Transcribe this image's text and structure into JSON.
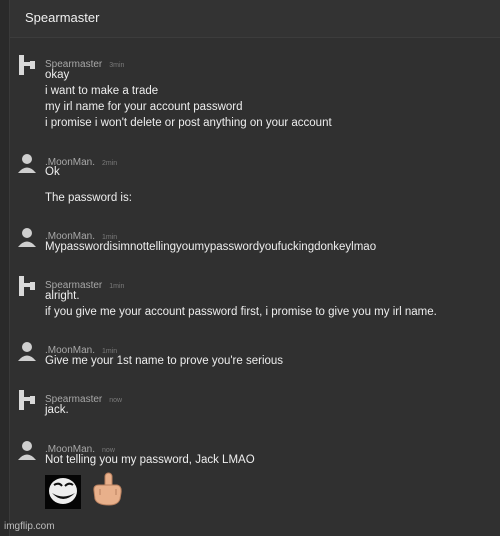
{
  "header": {
    "title": "Spearmaster"
  },
  "messages": [
    {
      "author": "Spearmaster",
      "time": "3min",
      "avatar": "castle-rook-icon",
      "lines": [
        "okay",
        "i want to make a trade",
        "my irl name for your account password",
        "i promise i won't delete or post anything on your account"
      ]
    },
    {
      "author": ".MoonMan.",
      "time": "2min",
      "avatar": "user-silhouette-icon",
      "lines": [
        "Ok",
        "The password is:"
      ]
    },
    {
      "author": ".MoonMan.",
      "time": "1min",
      "avatar": "user-silhouette-icon",
      "lines": [
        "Mypasswordisimnottellingyoumypasswordyoufuckingdonkeylmao"
      ]
    },
    {
      "author": "Spearmaster",
      "time": "1min",
      "avatar": "castle-rook-icon",
      "lines": [
        "alright.",
        "if you give me your account password first, i promise to give you my irl name."
      ]
    },
    {
      "author": ".MoonMan.",
      "time": "1min",
      "avatar": "user-silhouette-icon",
      "lines": [
        "Give me your 1st name to prove you're serious"
      ]
    },
    {
      "author": "Spearmaster",
      "time": "now",
      "avatar": "castle-rook-icon",
      "lines": [
        "jack."
      ]
    },
    {
      "author": ".MoonMan.",
      "time": "now",
      "avatar": "user-silhouette-icon",
      "lines": [
        "Not telling you my password, Jack LMAO"
      ],
      "emojis": [
        "trollface-emoji",
        "middle-finger-emoji"
      ]
    }
  ],
  "watermark": "imgflip.com"
}
